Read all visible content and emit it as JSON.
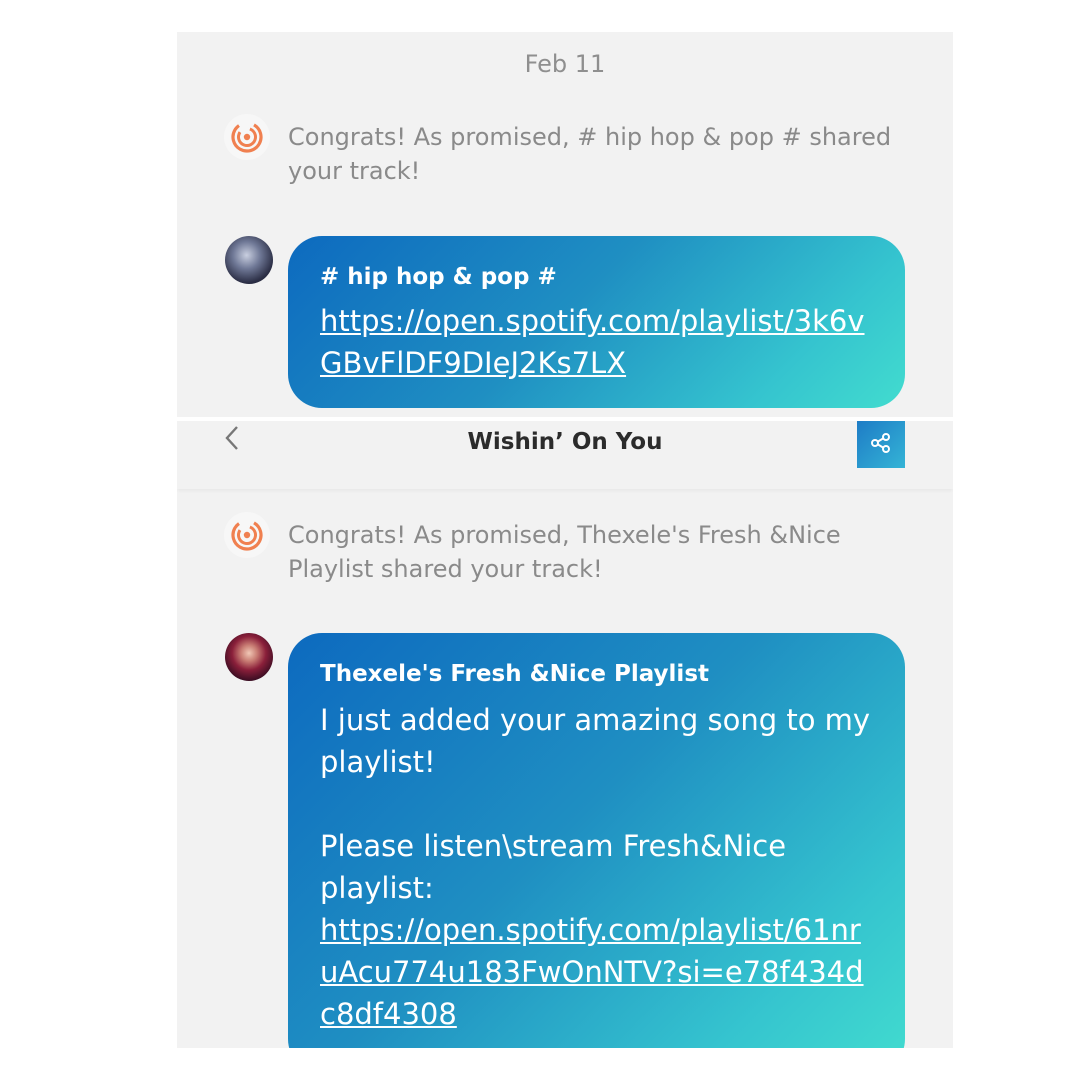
{
  "top": {
    "date": "Feb 11",
    "system_message": "Congrats! As promised, # hip hop & pop # shared your track!",
    "bubble": {
      "sender": "# hip hop & pop #",
      "link": "https://open.spotify.com/playlist/3k6vGBvFlDF9DIeJ2Ks7LX"
    }
  },
  "header": {
    "title": "Wishin’ On You",
    "back_icon": "chevron-left-icon",
    "share_icon": "share-icon"
  },
  "bottom": {
    "system_message": "Congrats! As promised, Thexele's Fresh &Nice Playlist shared your track!",
    "bubble": {
      "sender": "Thexele's Fresh &Nice Playlist",
      "text": "I just added your amazing song to my playlist!\n\nPlease listen\\stream Fresh&Nice playlist:",
      "link": "https://open.spotify.com/playlist/61nruAcu774u183FwOnNTV?si=e78f434dc8df4308"
    }
  },
  "colors": {
    "accent_orange": "#f08050",
    "bubble_start": "#0d6abf",
    "bubble_end": "#42dccf"
  }
}
